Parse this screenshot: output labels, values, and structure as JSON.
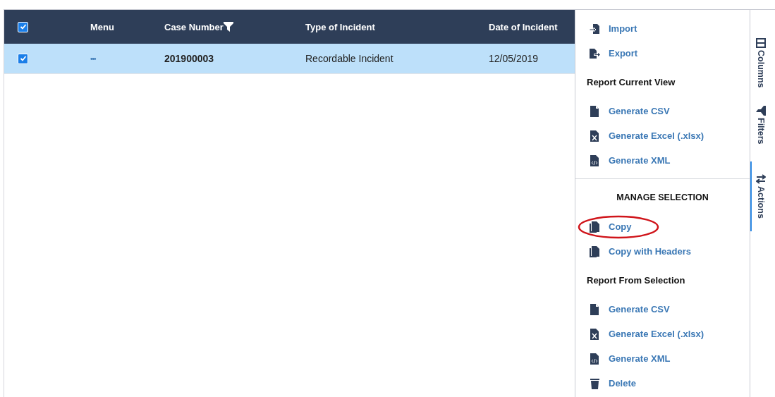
{
  "table": {
    "select_all_checked": true,
    "columns": [
      {
        "label": "Menu",
        "filter": false
      },
      {
        "label": "Case Number",
        "filter": true
      },
      {
        "label": "Type of Incident",
        "filter": false
      },
      {
        "label": "Date of Incident",
        "filter": false
      }
    ],
    "rows": [
      {
        "selected": true,
        "checked": true,
        "menu": "•••",
        "case_number": "201900003",
        "type": "Recordable Incident",
        "date": "12/05/2019"
      }
    ]
  },
  "actions_panel": {
    "items": [
      {
        "kind": "import",
        "label": "Import",
        "highlighted": false
      },
      {
        "kind": "export",
        "label": "Export",
        "highlighted": false
      },
      {
        "kind": "heading",
        "label": "Report Current View"
      },
      {
        "kind": "csv",
        "label": "Generate CSV",
        "highlighted": false
      },
      {
        "kind": "excel",
        "label": "Generate Excel (.xlsx)",
        "highlighted": false
      },
      {
        "kind": "xml",
        "label": "Generate XML",
        "highlighted": false
      },
      {
        "kind": "divider"
      },
      {
        "kind": "section",
        "label": "MANAGE SELECTION"
      },
      {
        "kind": "copy",
        "label": "Copy",
        "highlighted": true
      },
      {
        "kind": "copy",
        "label": "Copy with Headers",
        "highlighted": false
      },
      {
        "kind": "heading",
        "label": "Report From Selection"
      },
      {
        "kind": "csv",
        "label": "Generate CSV",
        "highlighted": false
      },
      {
        "kind": "excel",
        "label": "Generate Excel (.xlsx)",
        "highlighted": false
      },
      {
        "kind": "xml",
        "label": "Generate XML",
        "highlighted": false
      },
      {
        "kind": "delete",
        "label": "Delete",
        "highlighted": false
      }
    ]
  },
  "side_tabs": [
    {
      "label": "Columns",
      "selected": false
    },
    {
      "label": "Filters",
      "selected": false
    },
    {
      "label": "Actions",
      "selected": true
    }
  ]
}
